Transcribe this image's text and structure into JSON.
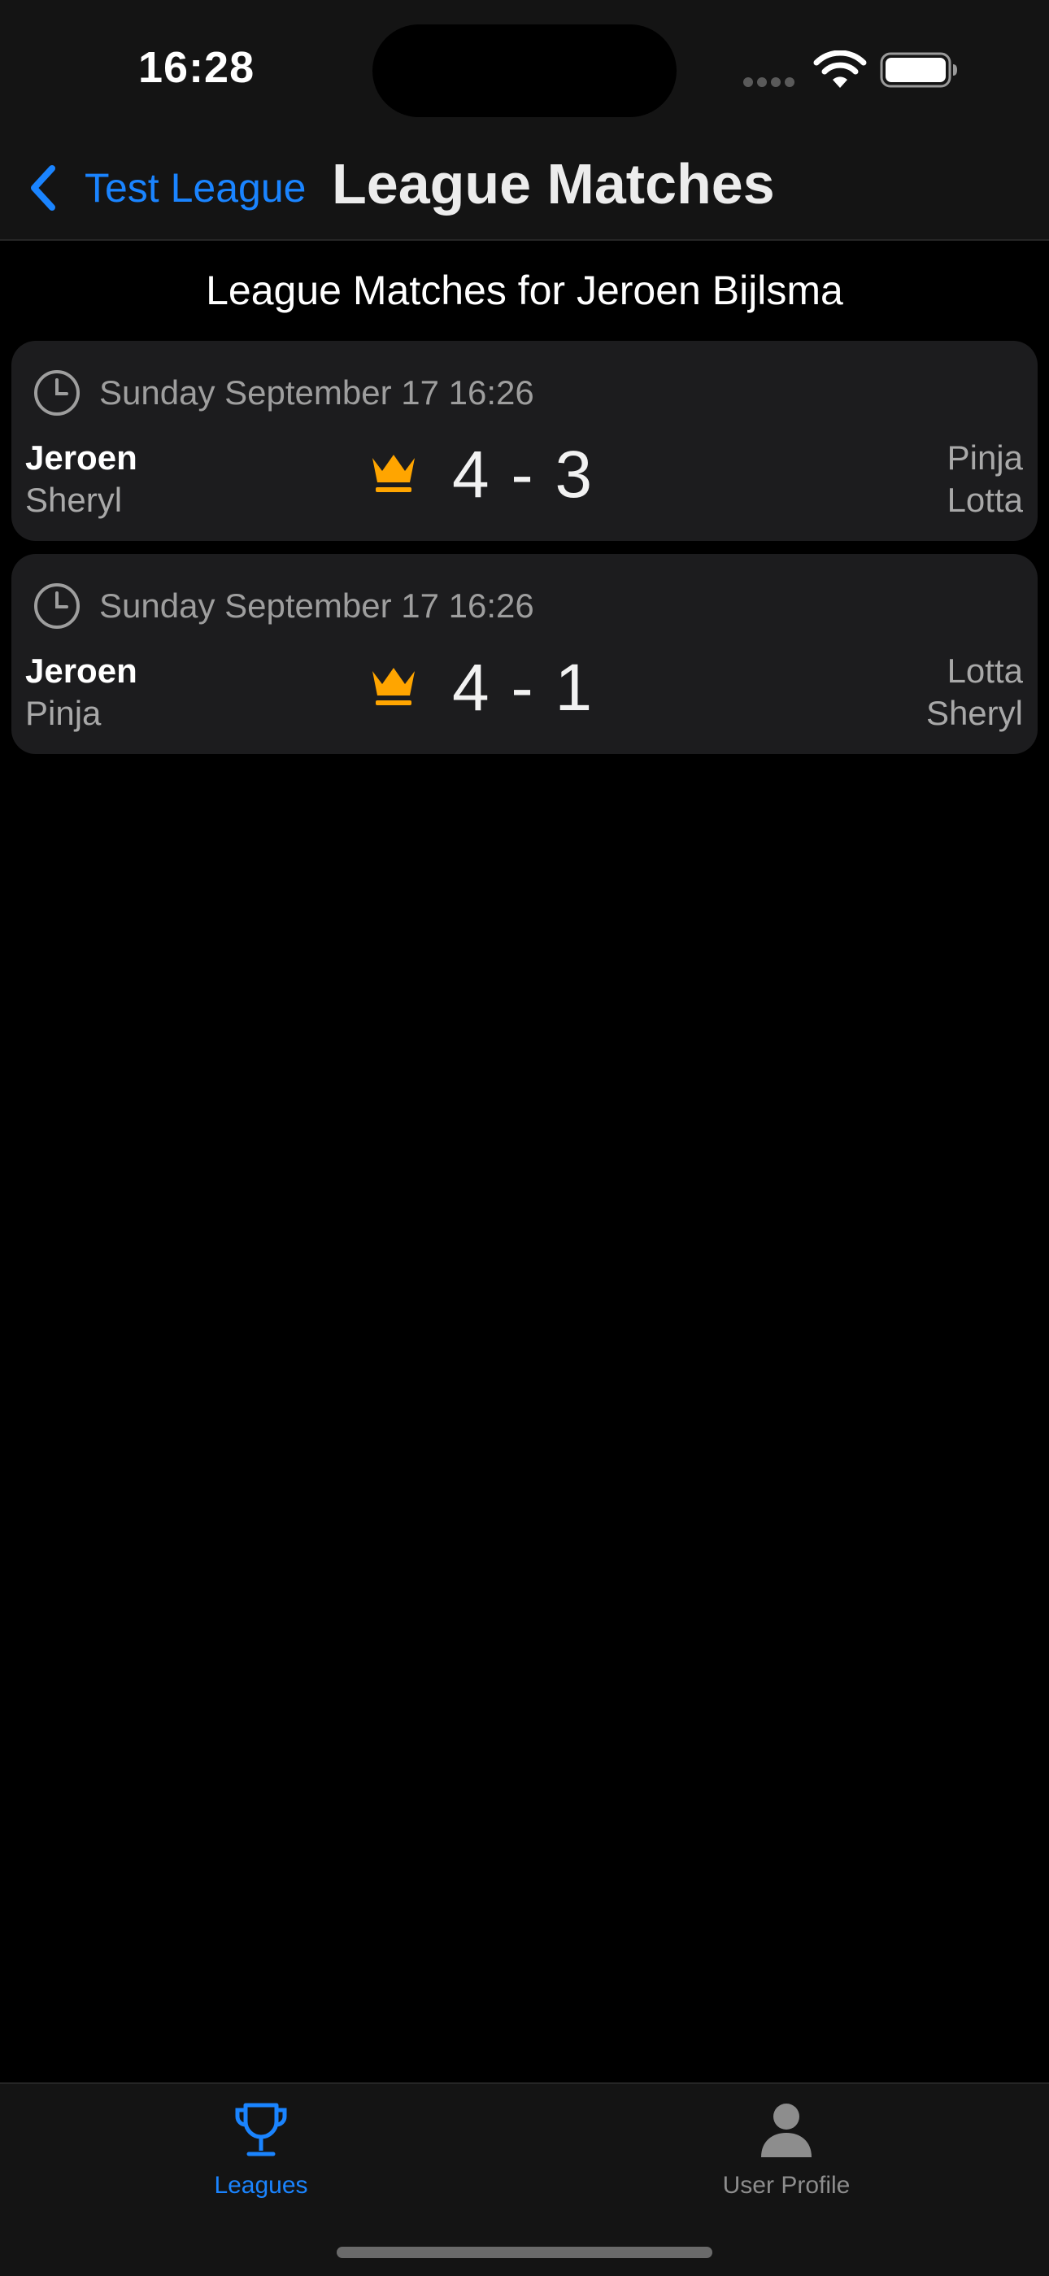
{
  "status_bar": {
    "time": "16:28"
  },
  "nav": {
    "back_label": "Test League",
    "title": "League Matches"
  },
  "subtitle": "League Matches for Jeroen Bijlsma",
  "matches": [
    {
      "date": "Sunday September 17 16:26",
      "left_team": [
        "Jeroen",
        "Sheryl"
      ],
      "score": "4 - 3",
      "right_team": [
        "Pinja",
        "Lotta"
      ],
      "winner_icon": "crown-icon"
    },
    {
      "date": "Sunday September 17 16:26",
      "left_team": [
        "Jeroen",
        "Pinja"
      ],
      "score": "4 - 1",
      "right_team": [
        "Lotta",
        "Sheryl"
      ],
      "winner_icon": "crown-icon"
    }
  ],
  "tabs": [
    {
      "label": "Leagues",
      "icon": "trophy-icon",
      "active": true
    },
    {
      "label": "User Profile",
      "icon": "person-icon",
      "active": false
    }
  ],
  "colors": {
    "accent": "#1a84ff",
    "crown": "#ffa500",
    "card": "#1c1c1e",
    "background": "#000000"
  }
}
